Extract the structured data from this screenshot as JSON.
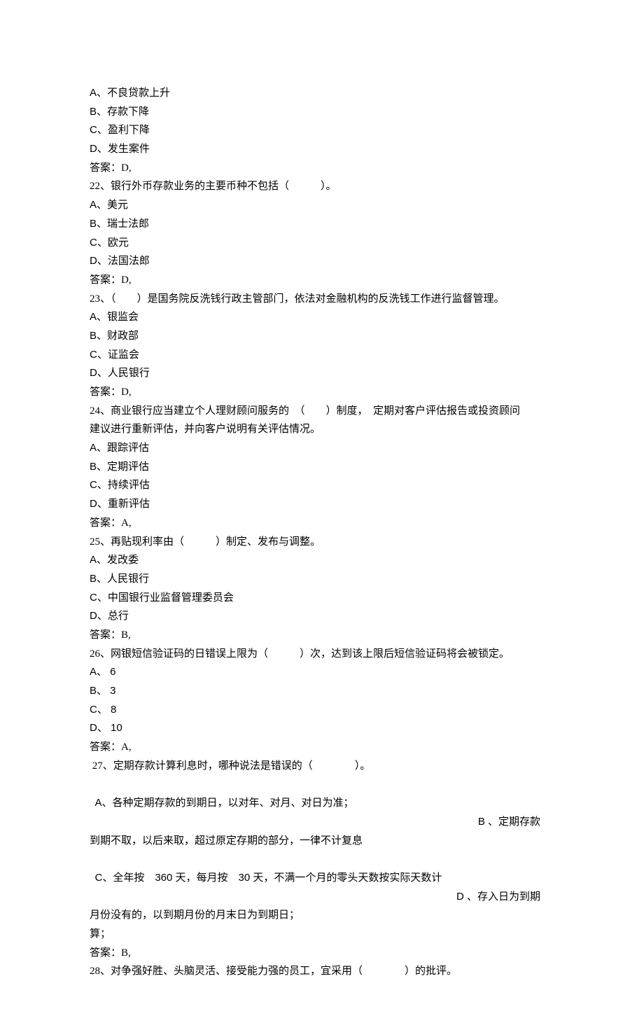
{
  "q21": {
    "optA": "A、不良贷款上升",
    "optB": "B、存款下降",
    "optC": "C、盈利下降",
    "optD": "D、发生案件",
    "answer": "答案：D,"
  },
  "q22": {
    "stem": "22、银行外币存款业务的主要币种不包括（　　　）。",
    "optA": "A、美元",
    "optB": "B、瑞士法郎",
    "optC": "C、欧元",
    "optD": "D、法国法郎",
    "answer": "答案：D,"
  },
  "q23": {
    "stem": "23、（　　）是国务院反洗钱行政主管部门，依法对金融机构的反洗钱工作进行监督管理。",
    "optA": "A、银监会",
    "optB": "B、财政部",
    "optC": "C、证监会",
    "optD": "D、人民银行",
    "answer": "答案：D,"
  },
  "q24": {
    "stem1": "24、商业银行应当建立个人理财顾问服务的　（　　）制度，　定期对客户评估报告或投资顾问",
    "stem2": "建议进行重新评估，并向客户说明有关评估情况。",
    "optA": "A、跟踪评估",
    "optB": "B、定期评估",
    "optC": "C、持续评估",
    "optD": "D、重新评估",
    "answer": "答案：A,"
  },
  "q25": {
    "stem": "25、再贴现利率由（　　　）制定、发布与调整。",
    "optA": "A、发改委",
    "optB": "B、人民银行",
    "optC": "C、中国银行业监督管理委员会",
    "optD": "D、总行",
    "answer": "答案：B,"
  },
  "q26": {
    "stem": "26、网银短信验证码的日错误上限为（　　　）次，达到该上限后短信验证码将会被锁定。",
    "optA": "A、 6",
    "optB": "B、 3",
    "optC": "C、 8",
    "optD": "D、 10",
    "answer": "答案：A,"
  },
  "q27": {
    "stem": " 27、定期存款计算利息时，哪种说法是错误的（　　　　）。",
    "optA_left": "A、各种定期存款的到期日，以对年、对月、对日为准；",
    "optB_right": "B 、定期存款",
    "optB_cont": "到期不取，以后来取，超过原定存期的部分，一律不计复息",
    "optC_left": "C、全年按　360 天，每月按　30 天，不满一个月的零头天数按实际天数计",
    "optD_right": "D 、存入日为到期",
    "optD_cont": "月份没有的，以到期月份的月末日为到期日；",
    "tail": "算；",
    "answer": "答案：B,"
  },
  "q28": {
    "stem": "28、对争强好胜、头脑灵活、接受能力强的员工，宜采用（　　　　）的批评。"
  }
}
